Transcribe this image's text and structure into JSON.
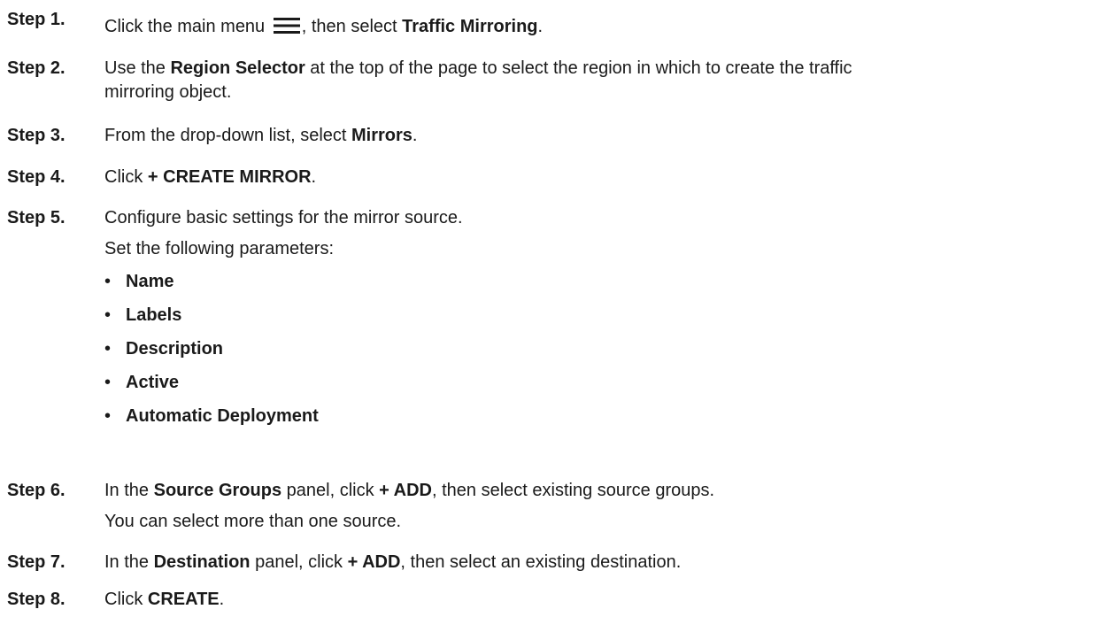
{
  "steps": [
    {
      "label": "Step 1.",
      "text": {
        "a": "Click the main menu ",
        "icon": "hamburger-menu-icon",
        "b": ", then select ",
        "bold": "Traffic Mirroring",
        "c": "."
      }
    },
    {
      "label": "Step 2.",
      "text": {
        "a": "Use the ",
        "bold": "Region Selector",
        "b": " at the top of the page to select the region in which to create the traffic",
        "c": "mirroring object."
      }
    },
    {
      "label": "Step 3.",
      "text": {
        "a": "From the drop-down list, select ",
        "bold": "Mirrors",
        "b": "."
      }
    },
    {
      "label": "Step 4.",
      "text": {
        "a": "Click ",
        "bold": "+ CREATE MIRROR",
        "b": "."
      }
    },
    {
      "label": "Step 5.",
      "text": {
        "a": "Configure basic settings for the mirror source.",
        "b": "Set the following parameters:"
      },
      "bullet_symbol": "•",
      "parameters": [
        "Name",
        "Labels",
        "Description",
        "Active",
        "Automatic Deployment"
      ]
    },
    {
      "label": "Step 6.",
      "text": {
        "a": "In the ",
        "bold": "Source Groups",
        "b": " panel, click ",
        "bold2": "+ ADD",
        "c": ", then select existing source groups.",
        "d": "You can select more than one source."
      }
    },
    {
      "label": "Step 7.",
      "text": {
        "a": "In the ",
        "bold": "Destination",
        "b": " panel, click ",
        "bold2": "+ ADD",
        "c": ", then select an existing destination."
      }
    },
    {
      "label": "Step 8.",
      "text": {
        "a": "Click ",
        "bold": "CREATE",
        "b": "."
      }
    }
  ]
}
